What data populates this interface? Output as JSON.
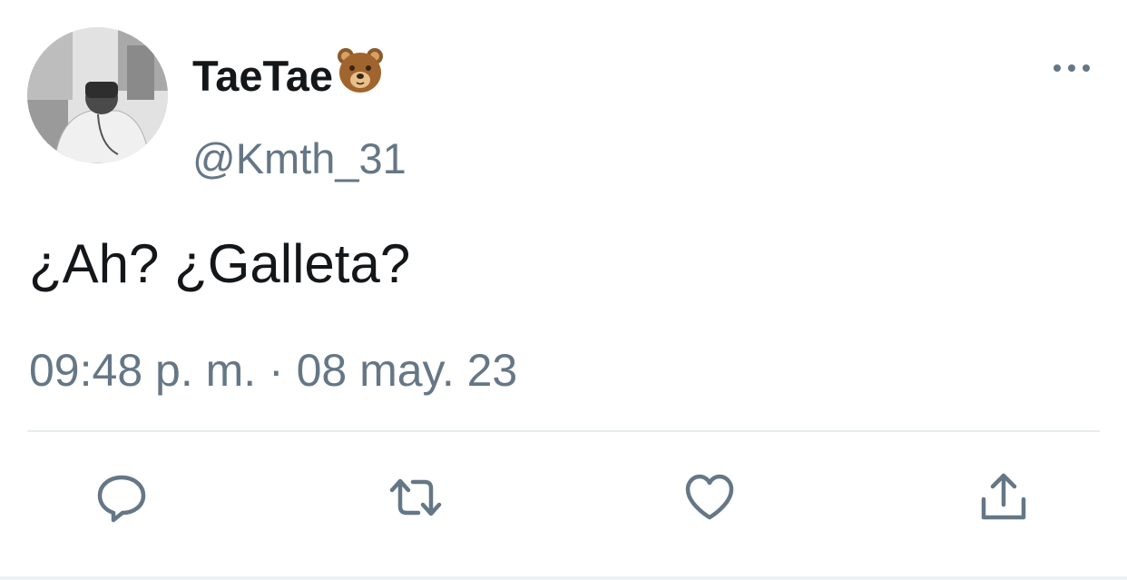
{
  "user": {
    "display_name": "TaeTae",
    "name_emoji": "bear-face-emoji",
    "handle": "@Kmth_31"
  },
  "tweet": {
    "text": "¿Ah? ¿Galleta?",
    "timestamp": "09:48 p. m. · 08 may. 23"
  },
  "actions": {
    "reply": "reply-icon",
    "retweet": "retweet-icon",
    "like": "heart-icon",
    "share": "share-icon"
  },
  "menu": {
    "more": "more-options-icon"
  },
  "colors": {
    "text": "#14171a",
    "secondary": "#657786",
    "divider": "#e6ecf0"
  }
}
